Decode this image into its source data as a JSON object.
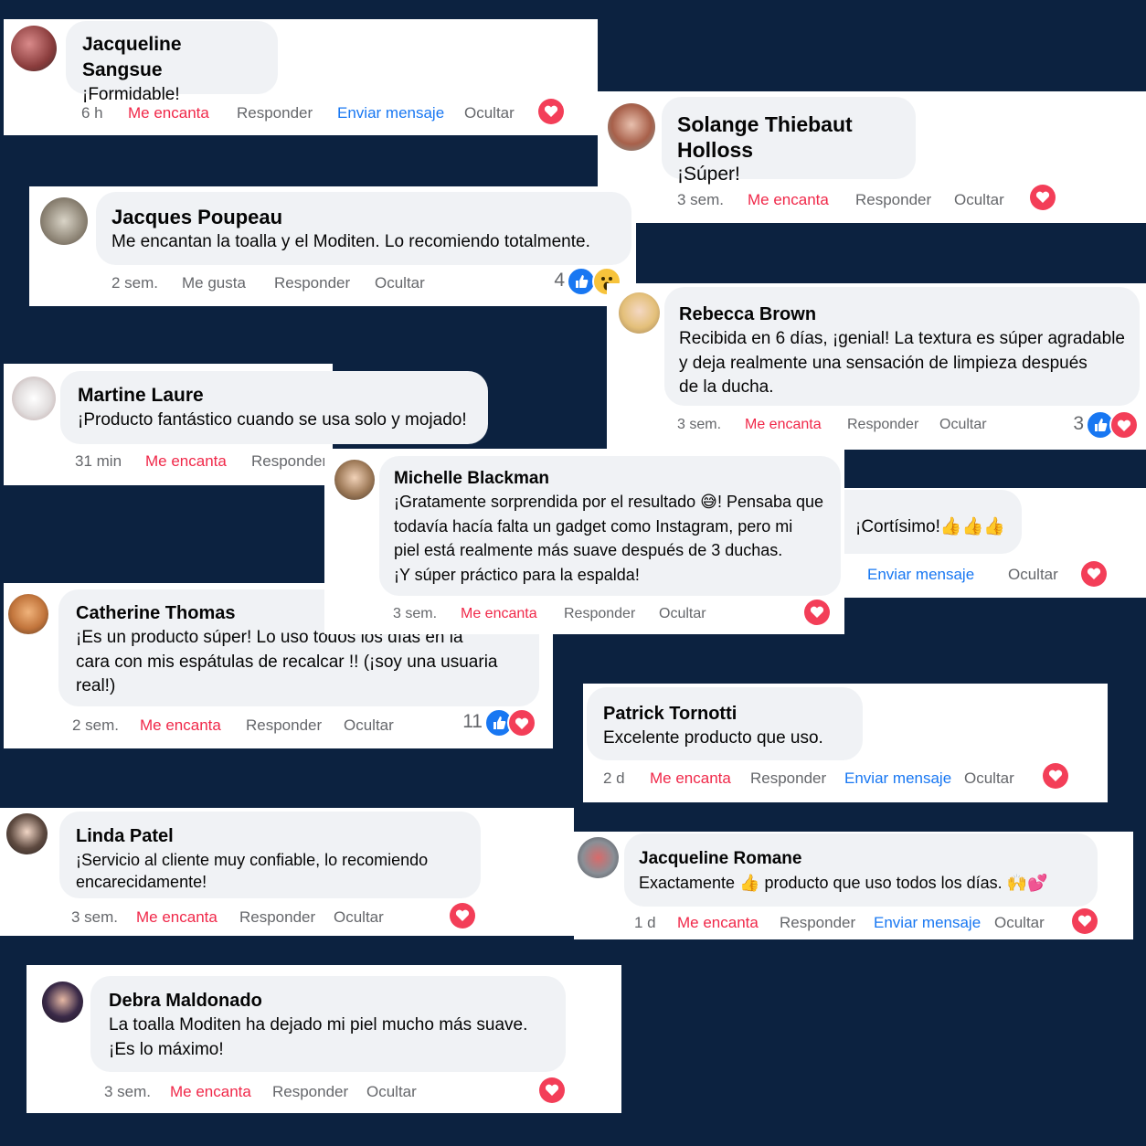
{
  "colors": {
    "background": "#0c2240",
    "love": "#f02849",
    "link": "#1877f2",
    "muted": "#65676b",
    "bubble": "#f0f2f5"
  },
  "comments": [
    {
      "name": "Jacqueline Sangsue",
      "text": [
        "¡Formidable!"
      ],
      "time": "6 h",
      "love": "Me encanta",
      "reply": "Responder",
      "message": "Enviar mensaje",
      "hide": "Ocultar",
      "reaction_icon": "heart-icon"
    },
    {
      "name": "Solange Thiebaut Holloss",
      "text": [
        "¡Súper!"
      ],
      "time": "3 sem.",
      "love": "Me encanta",
      "reply": "Responder",
      "hide": "Ocultar",
      "reaction_icon": "heart-icon"
    },
    {
      "name": "Jacques Poupeau",
      "text": [
        "Me encantan la toalla y el Moditen. Lo recomiendo totalmente."
      ],
      "time": "2 sem.",
      "like": "Me gusta",
      "reply": "Responder",
      "hide": "Ocultar",
      "reaction_count": "4",
      "reaction_icons": [
        "like-icon",
        "wow-icon"
      ]
    },
    {
      "name": "Rebecca Brown",
      "text": [
        "Recibida en 6 días, ¡genial! La textura es súper agradable",
        "y deja realmente una sensación de limpieza después",
        "de la ducha."
      ],
      "time": "3 sem.",
      "love": "Me encanta",
      "reply": "Responder",
      "hide": "Ocultar",
      "reaction_count": "3",
      "reaction_icons": [
        "like-icon",
        "heart-icon"
      ]
    },
    {
      "name": "Martine Laure",
      "text": [
        "¡Producto fantástico cuando se usa solo y mojado!"
      ],
      "time": "31 min",
      "love": "Me encanta",
      "reply": "Responder"
    },
    {
      "name": "Michelle Blackman",
      "text": [
        "¡Gratamente sorprendida por el resultado 😅! Pensaba que",
        "todavía hacía falta un gadget como Instagram, pero mi",
        "piel está realmente más suave después de 3 duchas.",
        "¡Y súper práctico para la espalda!"
      ],
      "time": "3 sem.",
      "love": "Me encanta",
      "reply": "Responder",
      "hide": "Ocultar",
      "reaction_icon": "heart-icon"
    },
    {
      "text": [
        "¡Cortísimo!👍👍👍"
      ],
      "message": "Enviar mensaje",
      "hide": "Ocultar",
      "reaction_icon": "heart-icon"
    },
    {
      "name": "Catherine Thomas",
      "text": [
        "¡Es un producto súper! Lo uso todos los días en la",
        "cara con mis espátulas de recalcar !! (¡soy una usuaria",
        "real!)"
      ],
      "time": "2 sem.",
      "love": "Me encanta",
      "reply": "Responder",
      "hide": "Ocultar",
      "reaction_count": "11",
      "reaction_icons": [
        "like-icon",
        "heart-icon"
      ]
    },
    {
      "name": "Patrick Tornotti",
      "text": [
        "Excelente producto que uso."
      ],
      "time": "2 d",
      "love": "Me encanta",
      "reply": "Responder",
      "message": "Enviar mensaje",
      "hide": "Ocultar",
      "reaction_icon": "heart-icon"
    },
    {
      "name": "Linda Patel",
      "text": [
        "¡Servicio al cliente muy confiable, lo recomiendo",
        "encarecidamente!"
      ],
      "time": "3 sem.",
      "love": "Me encanta",
      "reply": "Responder",
      "hide": "Ocultar",
      "reaction_icon": "heart-icon"
    },
    {
      "name": "Jacqueline Romane",
      "text": [
        "Exactamente 👍  producto que uso todos los días. 🙌💕"
      ],
      "time": "1 d",
      "love": "Me encanta",
      "reply": "Responder",
      "message": "Enviar mensaje",
      "hide": "Ocultar",
      "reaction_icon": "heart-icon"
    },
    {
      "name": "Debra Maldonado",
      "text": [
        "La toalla Moditen ha dejado mi piel mucho más suave.",
        "¡Es lo máximo!"
      ],
      "time": "3 sem.",
      "love": "Me encanta",
      "reply": "Responder",
      "hide": "Ocultar",
      "reaction_icon": "heart-icon"
    }
  ]
}
